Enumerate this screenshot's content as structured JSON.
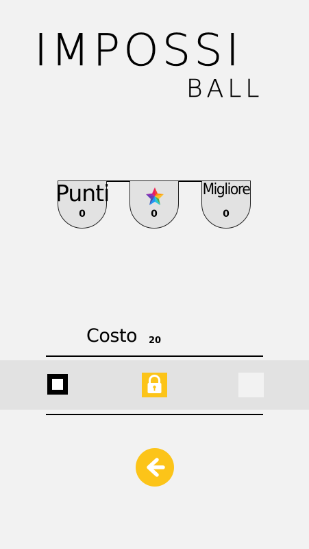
{
  "logo": {
    "title": "IMPOSSI",
    "subtitle": "BALL"
  },
  "stats": {
    "punti": {
      "label": "Punti",
      "value": "0"
    },
    "stelle": {
      "icon": "star-icon",
      "value": "0"
    },
    "migliore": {
      "label": "Migliore",
      "value": "0"
    }
  },
  "shop": {
    "costo_label": "Costo",
    "costo_value": "20",
    "items": [
      {
        "icon": "square-ball-icon",
        "state": "selected"
      },
      {
        "icon": "lock-icon",
        "state": "locked"
      },
      {
        "icon": "empty-slot",
        "state": "empty"
      }
    ]
  },
  "navigation": {
    "back_icon": "arrow-left-icon"
  },
  "colors": {
    "background": "#f2f2f2",
    "panel": "#e2e2e2",
    "accent": "#fcc419",
    "text": "#000000"
  }
}
